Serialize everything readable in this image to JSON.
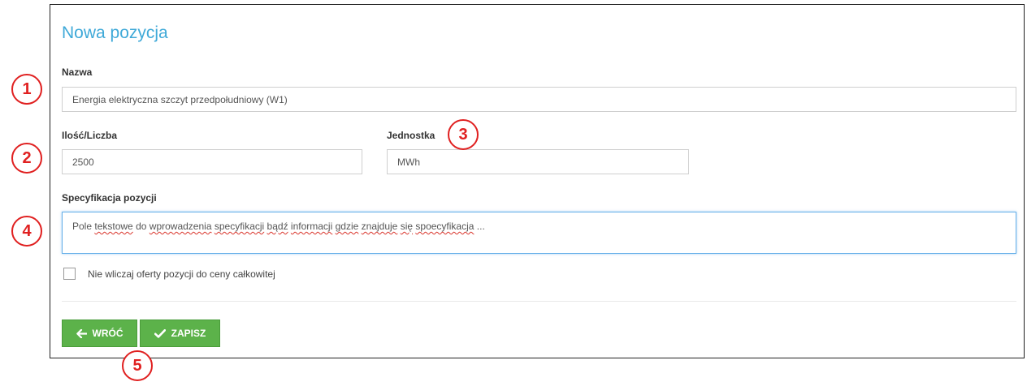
{
  "form": {
    "title": "Nowa pozycja",
    "name": {
      "label": "Nazwa",
      "value": "Energia elektryczna szczyt przedpołudniowy (W1)"
    },
    "quantity": {
      "label": "Ilość/Liczba",
      "value": "2500"
    },
    "unit": {
      "label": "Jednostka",
      "value": "MWh"
    },
    "spec": {
      "label": "Specyfikacja pozycji",
      "words": [
        "Pole",
        "tekstowe",
        "do",
        "wprowadzenia",
        "specyfikacji",
        "bądź",
        "informacji",
        "gdzie",
        "znajduje",
        "się",
        "spoecyfikacja",
        "..."
      ]
    },
    "exclude": {
      "label": "Nie wliczaj oferty pozycji do ceny całkowitej",
      "checked": false
    },
    "buttons": {
      "back": "WRÓĆ",
      "save": "ZAPISZ"
    }
  },
  "annotations": [
    "1",
    "2",
    "3",
    "4",
    "5"
  ],
  "colors": {
    "title": "#3fa9d8",
    "button": "#5cb24a",
    "annotation": "#e02020",
    "focus": "#66afe9"
  },
  "icons": {
    "back": "arrow-left-icon",
    "save": "checkmark-icon"
  }
}
